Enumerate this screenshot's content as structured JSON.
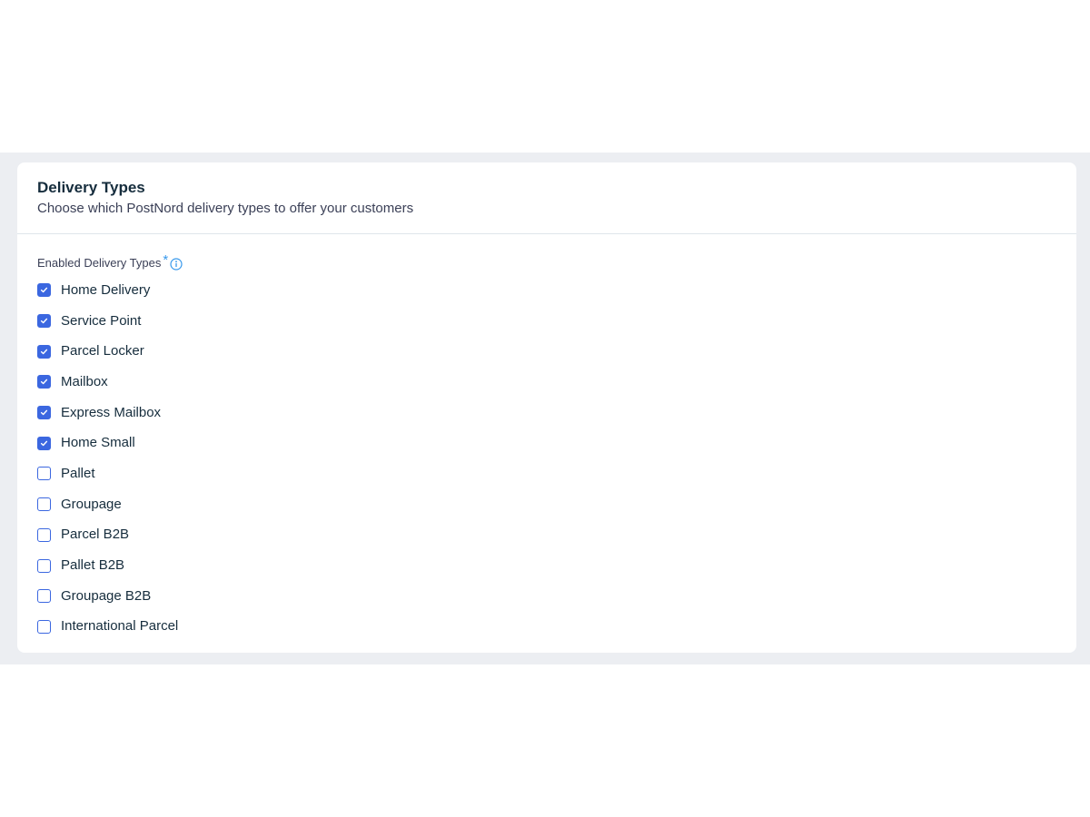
{
  "section": {
    "title": "Delivery Types",
    "subtitle": "Choose which PostNord delivery types to offer your customers"
  },
  "field": {
    "label": "Enabled Delivery Types",
    "required_marker": "*",
    "info_icon": "info-icon"
  },
  "options": [
    {
      "label": "Home Delivery",
      "checked": true
    },
    {
      "label": "Service Point",
      "checked": true
    },
    {
      "label": "Parcel Locker",
      "checked": true
    },
    {
      "label": "Mailbox",
      "checked": true
    },
    {
      "label": "Express Mailbox",
      "checked": true
    },
    {
      "label": "Home Small",
      "checked": true
    },
    {
      "label": "Pallet",
      "checked": false
    },
    {
      "label": "Groupage",
      "checked": false
    },
    {
      "label": "Parcel B2B",
      "checked": false
    },
    {
      "label": "Pallet B2B",
      "checked": false
    },
    {
      "label": "Groupage B2B",
      "checked": false
    },
    {
      "label": "International Parcel",
      "checked": false
    }
  ],
  "colors": {
    "accent": "#3b67e0",
    "info": "#3899ec",
    "background_band": "#eceef2",
    "text_primary": "#162d3d",
    "text_secondary": "#3b4057"
  }
}
